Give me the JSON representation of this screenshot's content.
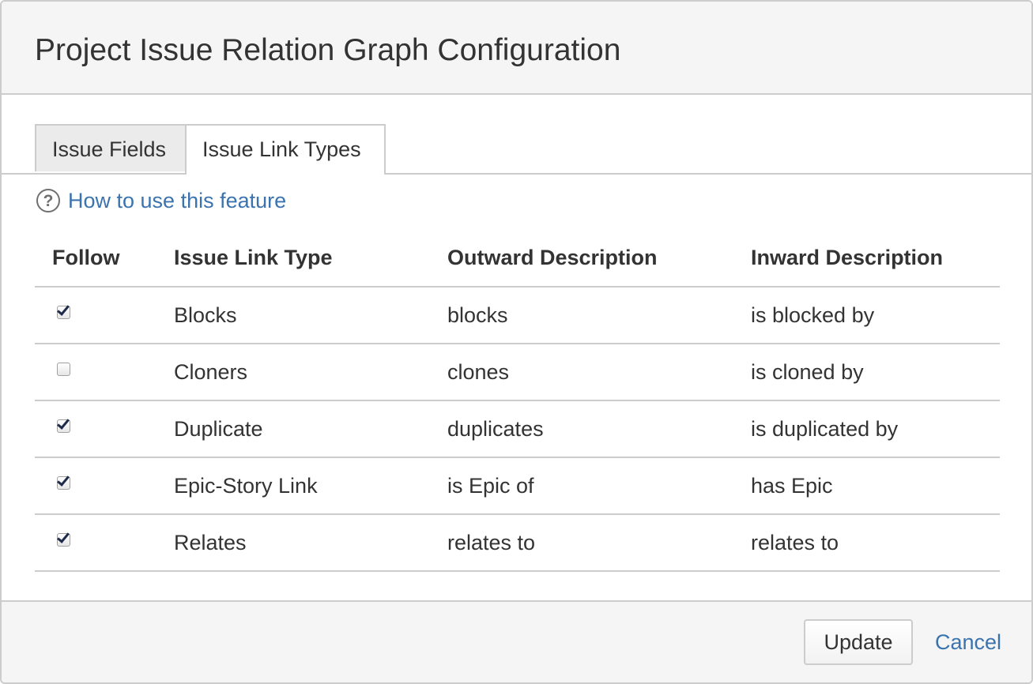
{
  "dialog": {
    "title": "Project Issue Relation Graph Configuration"
  },
  "tabs": [
    {
      "label": "Issue Fields",
      "active": false
    },
    {
      "label": "Issue Link Types",
      "active": true
    }
  ],
  "help": {
    "icon": "question-circle-icon",
    "link_text": "How to use this feature"
  },
  "table": {
    "headers": [
      "Follow",
      "Issue Link Type",
      "Outward Description",
      "Inward Description"
    ],
    "rows": [
      {
        "follow": true,
        "type": "Blocks",
        "outward": "blocks",
        "inward": "is blocked by"
      },
      {
        "follow": false,
        "type": "Cloners",
        "outward": "clones",
        "inward": "is cloned by"
      },
      {
        "follow": true,
        "type": "Duplicate",
        "outward": "duplicates",
        "inward": "is duplicated by"
      },
      {
        "follow": true,
        "type": "Epic-Story Link",
        "outward": "is Epic of",
        "inward": "has Epic"
      },
      {
        "follow": true,
        "type": "Relates",
        "outward": "relates to",
        "inward": "relates to"
      }
    ]
  },
  "footer": {
    "update_label": "Update",
    "cancel_label": "Cancel"
  },
  "colors": {
    "link": "#3b73af",
    "header_bg": "#f5f5f5",
    "border": "#cccccc"
  }
}
